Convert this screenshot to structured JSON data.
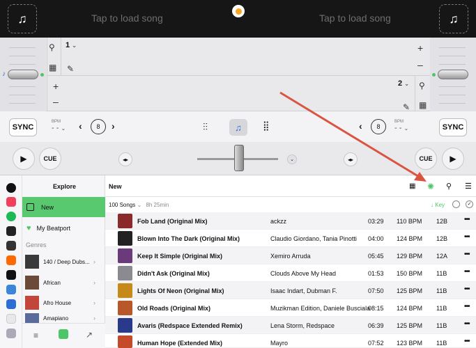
{
  "top": {
    "left_placeholder": "Tap to load song",
    "right_placeholder": "Tap to load song"
  },
  "decks": {
    "left_number": "1",
    "right_number": "2"
  },
  "controls": {
    "sync_label": "SYNC",
    "bpm_label": "BPM",
    "bpm_value": "- -",
    "loop_value": "8"
  },
  "transport": {
    "cue_label": "CUE",
    "play_label": "▶",
    "nudge_label": "◂▸"
  },
  "sidebar": {
    "title": "Explore",
    "items": [
      {
        "label": "New"
      },
      {
        "label": "My Beatport"
      }
    ],
    "section": "Genres",
    "genres": [
      {
        "label": "140 / Deep Dubs..."
      },
      {
        "label": "African"
      },
      {
        "label": "Afro House"
      },
      {
        "label": "Amapiano"
      }
    ]
  },
  "main": {
    "title": "New",
    "summary_count": "100 Songs",
    "summary_duration": "8h 25min",
    "sort_label": "Key",
    "tracks": [
      {
        "title": "Fob Land (Original Mix)",
        "artist": "ackzz",
        "time": "03:29",
        "bpm": "110 BPM",
        "key": "12B"
      },
      {
        "title": "Blown Into The Dark (Original Mix)",
        "artist": "Claudio Giordano, Tania Pinotti",
        "time": "04:00",
        "bpm": "124 BPM",
        "key": "12B"
      },
      {
        "title": "Keep It Simple (Original Mix)",
        "artist": "Xemiro Arruda",
        "time": "05:45",
        "bpm": "129 BPM",
        "key": "12A"
      },
      {
        "title": "Didn't Ask (Original Mix)",
        "artist": "Clouds Above My Head",
        "time": "01:53",
        "bpm": "150 BPM",
        "key": "11B"
      },
      {
        "title": "Lights Of Neon (Original Mix)",
        "artist": "Isaac Indart, Dubman F.",
        "time": "07:50",
        "bpm": "125 BPM",
        "key": "11B"
      },
      {
        "title": "Old Roads (Original Mix)",
        "artist": "Muzikman Edition, Daniele Busciala",
        "time": "08:15",
        "bpm": "124 BPM",
        "key": "11B"
      },
      {
        "title": "Avaris (Redspace Extended Remix)",
        "artist": "Lena Storm, Redspace",
        "time": "06:39",
        "bpm": "125 BPM",
        "key": "11B"
      },
      {
        "title": "Human Hope (Extended Mix)",
        "artist": "Mayro",
        "time": "07:52",
        "bpm": "123 BPM",
        "key": "11B"
      }
    ]
  },
  "colors": {
    "accent": "#4fc56a",
    "record": "#f5a623",
    "annotation_arrow": "#d9553f"
  }
}
